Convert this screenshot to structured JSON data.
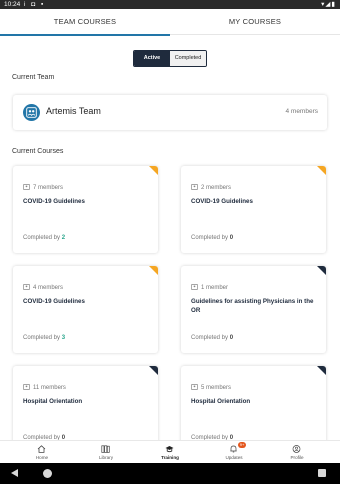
{
  "status_bar": {
    "time": "10:24",
    "left_icons": "i ◘ ▪",
    "right_icons": "▾◢▮"
  },
  "tabs": [
    {
      "label": "TEAM COURSES",
      "active": true
    },
    {
      "label": "MY COURSES",
      "active": false
    }
  ],
  "filter": {
    "active_label": "Active",
    "completed_label": "Completed",
    "selected": "Active"
  },
  "current_team": {
    "section_label": "Current Team",
    "name": "Artemis Team",
    "members": "4 members",
    "icon": "team-icon"
  },
  "current_courses": {
    "section_label": "Current Courses",
    "completed_prefix": "Completed by",
    "items": [
      {
        "members": "7 members",
        "title": "COVID-19 Guidelines",
        "completed_count": "2",
        "corner": "#f5a623",
        "count_color": "#27a58a"
      },
      {
        "members": "2 members",
        "title": "COVID-19 Guidelines",
        "completed_count": "0",
        "corner": "#f5a623",
        "count_color": "#444444"
      },
      {
        "members": "4 members",
        "title": "COVID-19 Guidelines",
        "completed_count": "3",
        "corner": "#f5a623",
        "count_color": "#27a58a"
      },
      {
        "members": "1 member",
        "title": "Guidelines for assisting Physicians in the OR",
        "completed_count": "0",
        "corner": "#1f2b3d",
        "count_color": "#444444"
      },
      {
        "members": "11 members",
        "title": "Hospital Orientation",
        "completed_count": "0",
        "corner": "#1f2b3d",
        "count_color": "#444444"
      },
      {
        "members": "5 members",
        "title": "Hospital Orientation",
        "completed_count": "0",
        "corner": "#1f2b3d",
        "count_color": "#444444"
      }
    ]
  },
  "bottom_nav": [
    {
      "label": "Home",
      "icon": "home-icon"
    },
    {
      "label": "Library",
      "icon": "library-icon"
    },
    {
      "label": "Training",
      "icon": "graduation-cap-icon",
      "active": true
    },
    {
      "label": "Updates",
      "icon": "bell-icon",
      "badge": "9+"
    },
    {
      "label": "Profile",
      "icon": "profile-icon"
    }
  ],
  "colors": {
    "accent": "#2276a8",
    "dark": "#1f2b3d",
    "orange": "#f5a623",
    "badge": "#e4571e"
  }
}
